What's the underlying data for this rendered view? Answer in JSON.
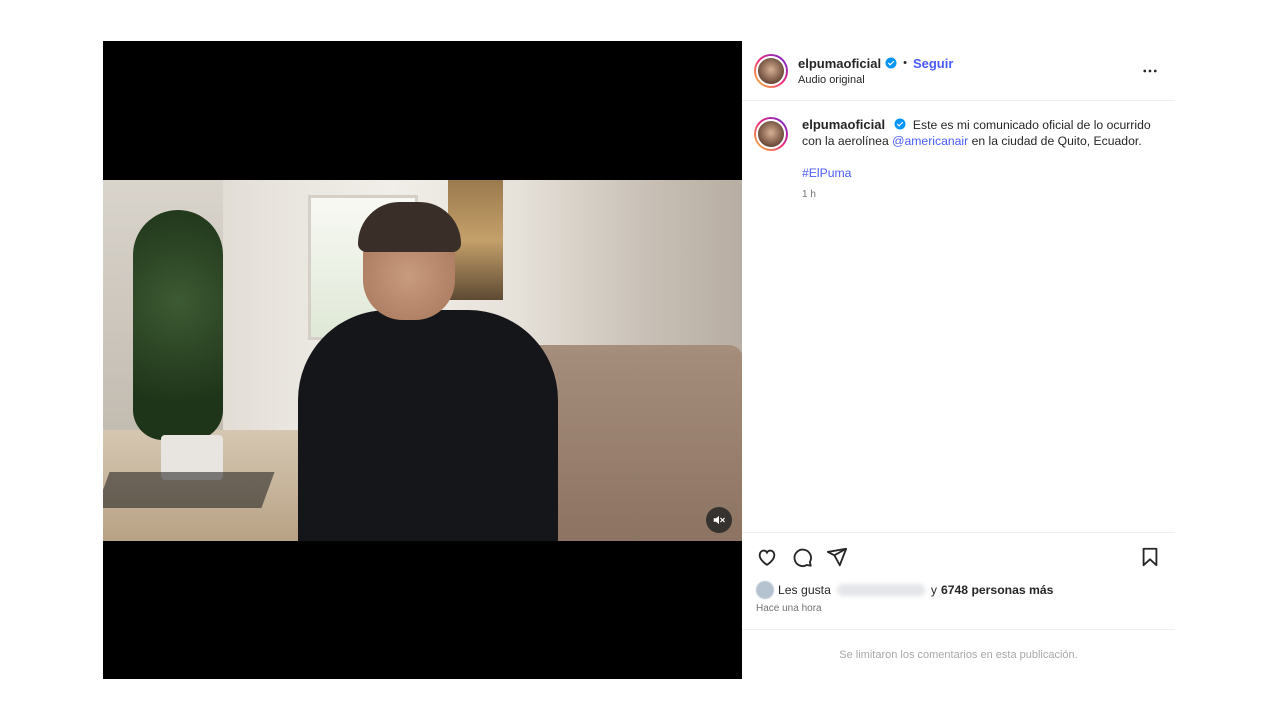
{
  "post": {
    "author": {
      "username": "elpumaoficial",
      "verified": true,
      "follow_label": "Seguir",
      "audio_label": "Audio original",
      "separator": "•"
    },
    "caption": {
      "username": "elpumaoficial",
      "text_before_mention": "Este es mi comunicado oficial de lo ocurrido con la aerolínea",
      "mention": "@americanair",
      "text_after_mention": "en la ciudad de Quito, Ecuador.",
      "hashtag": "#ElPuma",
      "time": "1 h"
    },
    "actions": {
      "like_icon": "heart-icon",
      "comment_icon": "comment-icon",
      "share_icon": "share-icon",
      "save_icon": "bookmark-icon"
    },
    "likes": {
      "prefix": "Les gusta",
      "connector": "y",
      "count_text": "6748 personas más"
    },
    "time_ago": "Hace una hora",
    "comments_disabled_text": "Se limitaron los comentarios en esta publicación.",
    "video": {
      "mute_icon": "muted-speaker-icon"
    }
  },
  "colors": {
    "link_blue": "#4a5df9",
    "verified_blue": "#0095f6",
    "muted_text": "#737373",
    "divider": "#efefef"
  }
}
